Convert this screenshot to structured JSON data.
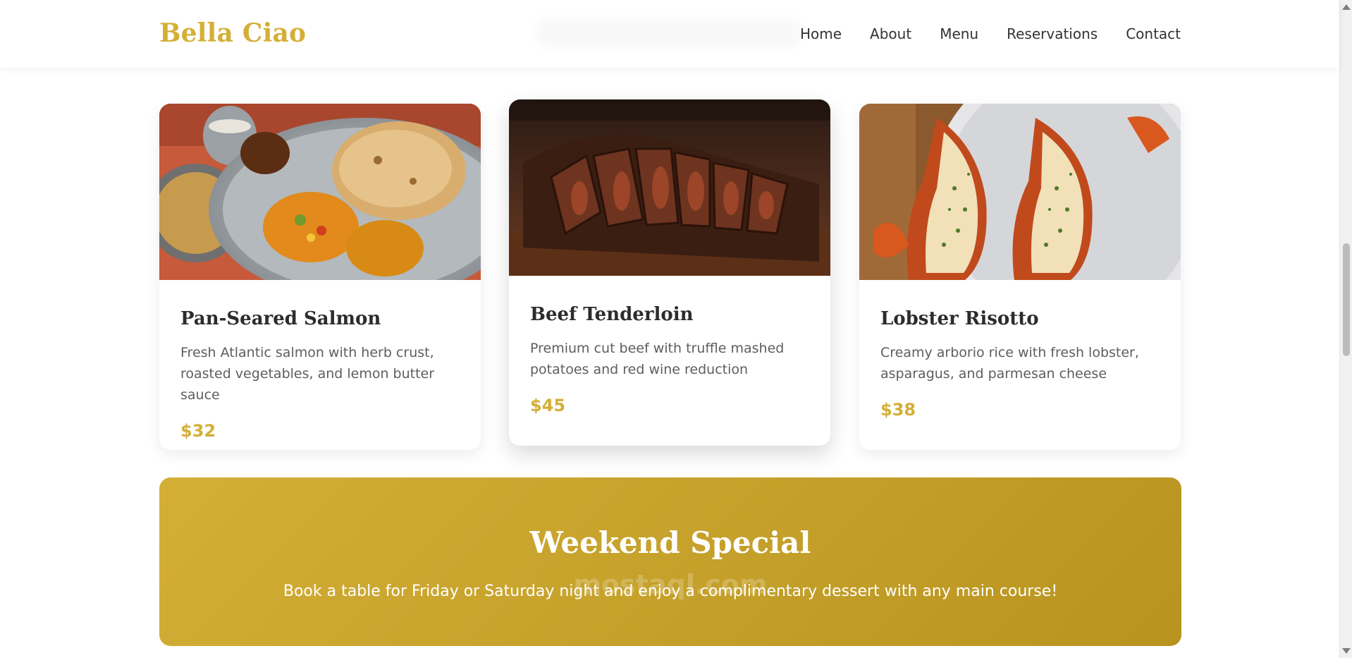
{
  "brand": {
    "name": "Bella Ciao",
    "color": "#D4AF37"
  },
  "nav": {
    "links": [
      "Home",
      "About",
      "Menu",
      "Reservations",
      "Contact"
    ]
  },
  "menu": {
    "items": [
      {
        "title": "Pan-Seared Salmon",
        "description": "Fresh Atlantic salmon with herb crust, roasted vegetables, and lemon butter sauce",
        "price": "$32",
        "image": "thali-plate-photo"
      },
      {
        "title": "Beef Tenderloin",
        "description": "Premium cut beef with truffle mashed potatoes and red wine reduction",
        "price": "$45",
        "image": "sliced-beef-photo"
      },
      {
        "title": "Lobster Risotto",
        "description": "Creamy arborio rice with fresh lobster, asparagus, and parmesan cheese",
        "price": "$38",
        "image": "grilled-lobster-photo"
      }
    ]
  },
  "banner": {
    "title": "Weekend Special",
    "text": "Book a table for Friday or Saturday night and enjoy a complimentary dessert with any main course!",
    "colors": [
      "#D4AF37",
      "#B8941F"
    ]
  },
  "watermark": {
    "text": "mostaql.com"
  }
}
